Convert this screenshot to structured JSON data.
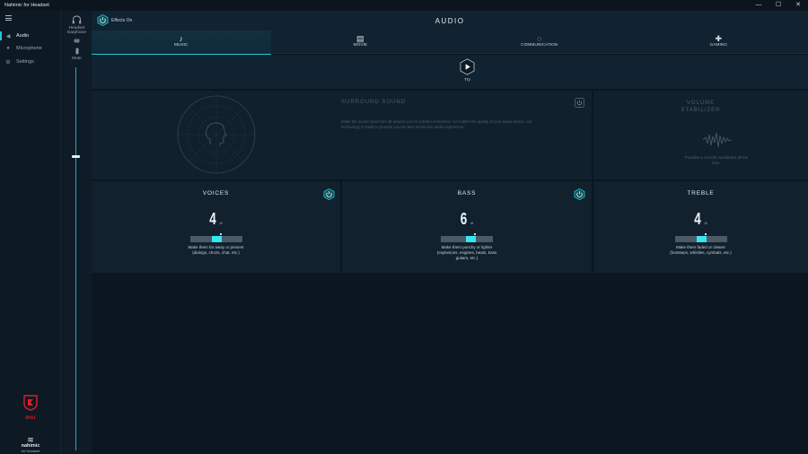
{
  "window": {
    "title": "Nahimic for Headset",
    "controls": [
      "—",
      "☐",
      "✕"
    ]
  },
  "sidebar": {
    "items": [
      {
        "label": "Audio",
        "icon": "speaker-icon",
        "active": true
      },
      {
        "label": "Microphone",
        "icon": "microphone-icon",
        "active": false
      },
      {
        "label": "Settings",
        "icon": "gear-icon",
        "active": false
      }
    ],
    "brand": {
      "msi": "msi",
      "nahimic": "nahimic",
      "nahimic_sub": "for Headset"
    }
  },
  "devices": {
    "headset_label_1": "Headset",
    "headset_label_2": "Earphone",
    "mute_label": "Mute",
    "volume_level": 0.77
  },
  "header": {
    "effects_label": "Effects On",
    "title": "AUDIO",
    "tabs": [
      {
        "label": "MUSIC",
        "icon": "music-note-icon",
        "active": true
      },
      {
        "label": "MOVIE",
        "icon": "clapperboard-icon",
        "active": false
      },
      {
        "label": "COMMUNICATION",
        "icon": "chat-bubble-icon",
        "active": false
      },
      {
        "label": "GAMING",
        "icon": "gamepad-icon",
        "active": false
      }
    ]
  },
  "try": {
    "label": "Try"
  },
  "surround": {
    "title": "SURROUND SOUND",
    "desc_line1": "Make the sound clear from all around you for a better immersion. No matter the quality of your audio device, our",
    "desc_line2": "technology is made to provide you the best immersive audio experience."
  },
  "stabilizer": {
    "title_line1": "VOLUME",
    "title_line2": "STABILIZER",
    "desc_line1": "Provides a smooth soundtrack all the",
    "desc_line2": "time."
  },
  "eq": {
    "voices": {
      "title": "VOICES",
      "value": "4",
      "unit": "dB",
      "desc_line1": "Make them far away or present",
      "desc_line2": "(dialogs, choirs, chat, etc.)",
      "level": 0.6
    },
    "bass": {
      "title": "BASS",
      "value": "6",
      "unit": "dB",
      "desc_line1": "Make them punchy or lighter",
      "desc_line2": "(explosions, engines, beats, bass",
      "desc_line3": "guitars, etc.)",
      "level": 0.68
    },
    "treble": {
      "title": "TREBLE",
      "value": "4",
      "unit": "dB",
      "desc_line1": "Make them faded or clearer",
      "desc_line2": "(footsteps, whistles, cymbals, etc.)",
      "level": 0.6
    }
  },
  "colors": {
    "accent": "#22c7d6",
    "fill": "#33e6ef",
    "msi_red": "#e11d2b"
  }
}
